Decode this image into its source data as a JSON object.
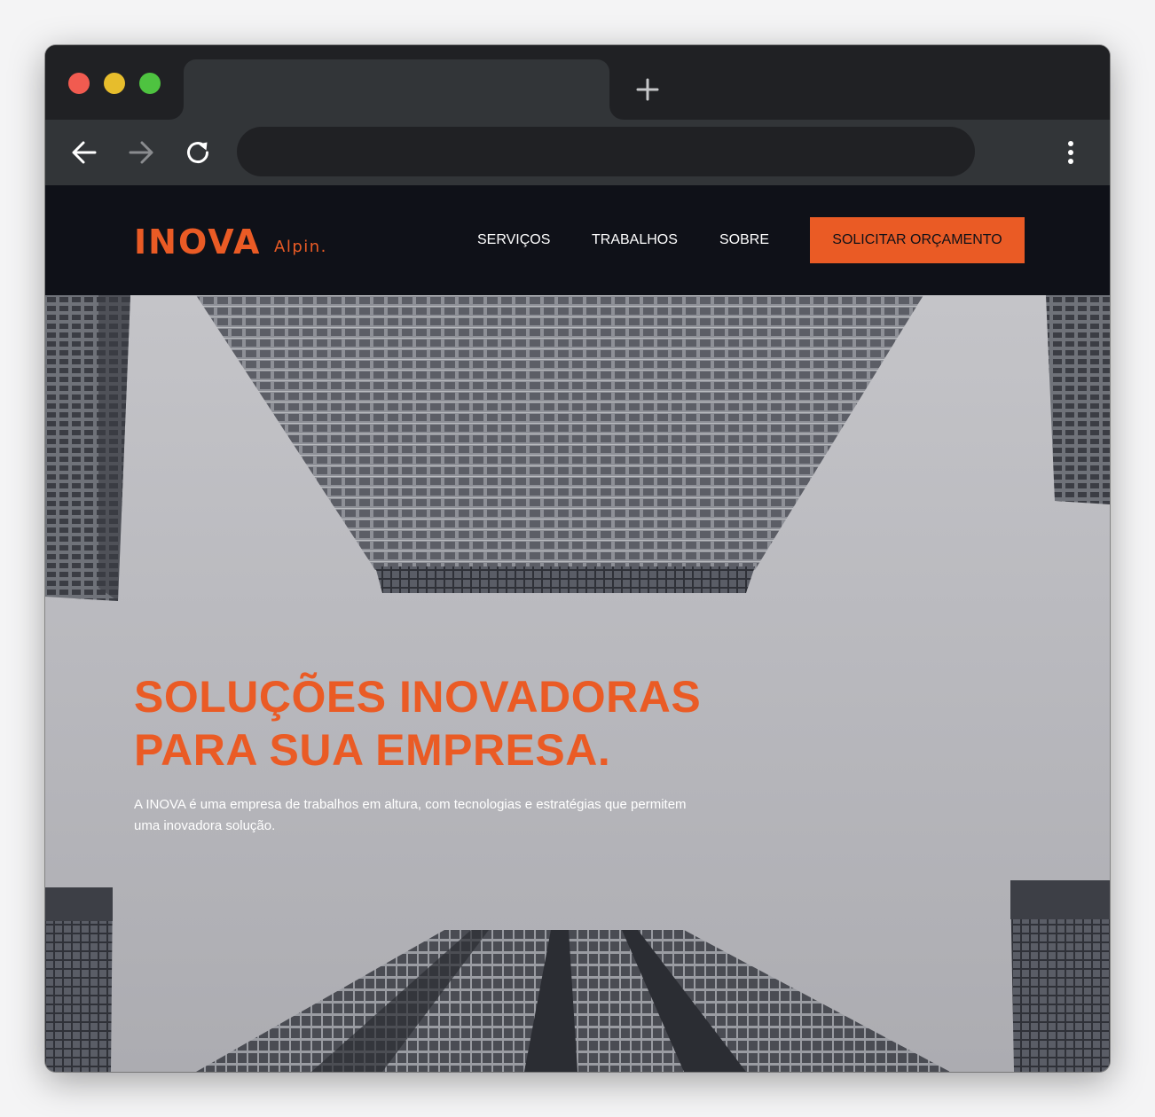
{
  "browser": {
    "tab_title": "",
    "url": "",
    "icons": {
      "new_tab": "plus-icon",
      "back": "arrow-left-icon",
      "forward": "arrow-right-icon",
      "reload": "reload-icon",
      "menu": "kebab-menu-icon"
    }
  },
  "site": {
    "logo": {
      "word": "INOVA",
      "sub": "Alpin."
    },
    "nav": {
      "servicos": "SERVIÇOS",
      "trabalhos": "TRABALHOS",
      "sobre": "SOBRE",
      "cta": "SOLICITAR ORÇAMENTO"
    },
    "hero": {
      "title_line1": "SOLUÇÕES INOVADORAS",
      "title_line2": "PARA SUA EMPRESA.",
      "text": "A INOVA é uma empresa de trabalhos em altura, com tecnologias e estratégias que permitem uma inovadora solução.",
      "background": "skyscrapers-photo"
    }
  },
  "colors": {
    "accent": "#ea5b25",
    "header_bg": "#0f1118",
    "chrome_dark": "#202124",
    "chrome_tab": "#323538"
  }
}
